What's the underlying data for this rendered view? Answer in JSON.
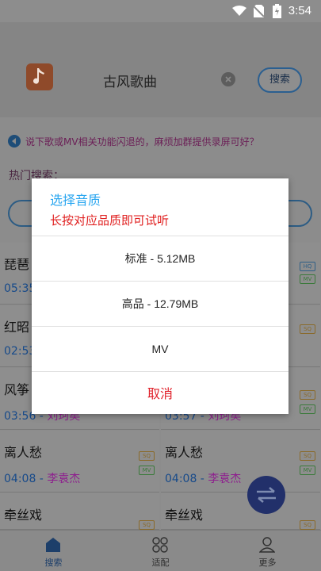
{
  "status_bar": {
    "time": "3:54"
  },
  "header": {
    "search_text": "古风歌曲",
    "search_button": "搜索"
  },
  "notice": "说下歌或MV相关功能闪退的，麻烦加群提供录屏可好？",
  "hot_label": "热门搜索：",
  "songs": [
    {
      "title": "琵琶",
      "duration": "05:35",
      "artist": "",
      "badges": [
        "HQ",
        "MV"
      ]
    },
    {
      "title": "",
      "duration": "",
      "artist": "",
      "badges": [
        "HQ",
        "MV"
      ]
    },
    {
      "title": "红昭",
      "duration": "02:53",
      "artist": "",
      "badges": [
        "SQ"
      ]
    },
    {
      "title": "",
      "duration": "",
      "artist": "",
      "badges": [
        "SQ"
      ]
    },
    {
      "title": "风筝",
      "duration": "03:56",
      "artist": "刘珂矣",
      "badges": [
        "SQ",
        "MV"
      ]
    },
    {
      "title": "",
      "duration": "03:57",
      "artist": "刘珂矣",
      "badges": [
        "SQ",
        "MV"
      ]
    },
    {
      "title": "离人愁",
      "duration": "04:08",
      "artist": "李袁杰",
      "badges": [
        "SQ",
        "MV"
      ]
    },
    {
      "title": "离人愁",
      "duration": "04:08",
      "artist": "李袁杰",
      "badges": [
        "SQ",
        "MV"
      ]
    },
    {
      "title": "牵丝戏",
      "duration": "",
      "artist": "",
      "badges": [
        "SQ"
      ]
    },
    {
      "title": "牵丝戏",
      "duration": "",
      "artist": "",
      "badges": [
        "SQ"
      ]
    }
  ],
  "dialog": {
    "title": "选择音质",
    "subtitle": "长按对应品质即可试听",
    "options": [
      "标准 - 5.12MB",
      "高品 - 12.79MB",
      "MV"
    ],
    "cancel": "取消"
  },
  "bottom_nav": [
    {
      "label": "搜索",
      "icon": "home-icon"
    },
    {
      "label": "适配",
      "icon": "grid-icon"
    },
    {
      "label": "更多",
      "icon": "person-icon"
    }
  ],
  "colors": {
    "dialog_title": "#29a6f0",
    "dialog_subtitle": "#e02020",
    "cancel": "#e0202a",
    "artist": "#8e1e8e",
    "duration": "#174a8a"
  }
}
